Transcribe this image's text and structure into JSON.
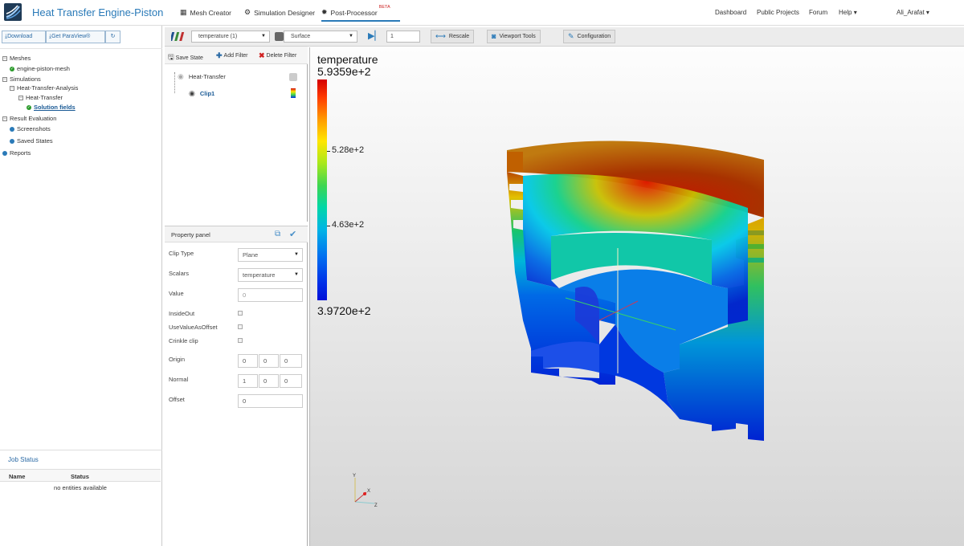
{
  "app": {
    "title": "Heat Transfer Engine-Piston"
  },
  "topnav": {
    "mesh_creator": "Mesh Creator",
    "simulation_designer": "Simulation Designer",
    "post_processor": "Post-Processor",
    "beta": "BETA"
  },
  "rightnav": {
    "dashboard": "Dashboard",
    "public_projects": "Public Projects",
    "forum": "Forum",
    "help": "Help",
    "user": "Ali_Arafat"
  },
  "left": {
    "download": "Download",
    "get_paraview": "Get ParaView®",
    "tree": {
      "meshes": "Meshes",
      "mesh_item": "engine-piston-mesh",
      "simulations": "Simulations",
      "analysis": "Heat-Transfer-Analysis",
      "run": "Heat-Transfer",
      "solution_fields": "Solution fields",
      "result_evaluation": "Result Evaluation",
      "screenshots": "Screenshots",
      "saved_states": "Saved States",
      "reports": "Reports"
    },
    "job_status": {
      "title": "Job Status",
      "col_name": "Name",
      "col_status": "Status",
      "empty": "no entities available"
    }
  },
  "toolbar": {
    "field_select": "temperature (1)",
    "repr_select": "Surface",
    "frame_value": "1",
    "rescale": "Rescale",
    "viewport_tools": "Viewport Tools",
    "configuration": "Configuration"
  },
  "pipeline": {
    "save_state": "Save State",
    "add_filter": "Add Filter",
    "delete_filter": "Delete Filter",
    "root": "Heat-Transfer",
    "child": "Clip1"
  },
  "property": {
    "title": "Property panel",
    "clip_type_label": "Clip Type",
    "clip_type_value": "Plane",
    "scalars_label": "Scalars",
    "scalars_value": "temperature",
    "value_label": "Value",
    "value_value": "0",
    "insideout_label": "InsideOut",
    "usevalueasoffset_label": "UseValueAsOffset",
    "crinkle_label": "Crinkle clip",
    "origin_label": "Origin",
    "origin": [
      "0",
      "0",
      "0"
    ],
    "normal_label": "Normal",
    "normal": [
      "1",
      "0",
      "0"
    ],
    "offset_label": "Offset",
    "offset_value": "0"
  },
  "colorbar": {
    "field": "temperature",
    "max": "5.9359e+2",
    "mid_upper": "5.28e+2",
    "mid_lower": "4.63e+2",
    "min": "3.9720e+2",
    "colors": [
      "#d40000",
      "#ffe600",
      "#3ed651",
      "#00b4e6",
      "#0010d8"
    ]
  },
  "axes": {
    "x": "X",
    "y": "Y",
    "z": "Z"
  }
}
